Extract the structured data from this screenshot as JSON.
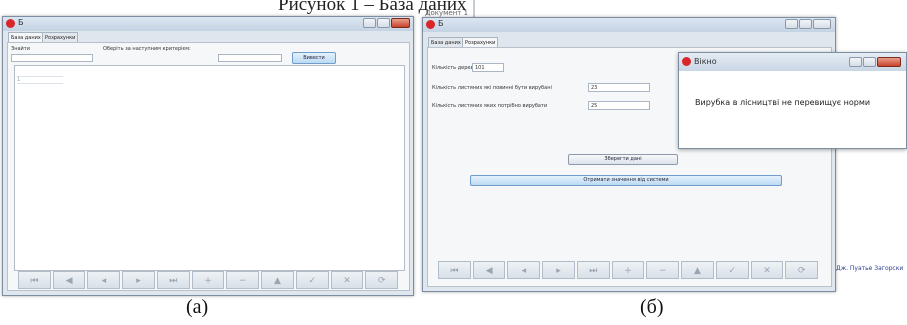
{
  "caption_top": "Рисунок 1 – База даних",
  "left": {
    "title": "Б",
    "tabs": [
      "База даних",
      "Розрахунки"
    ],
    "search_label": "Знайти",
    "hint": "Оберіть за наступним критерієм:",
    "button": "Вивести",
    "grid_rows": [
      "",
      "1"
    ],
    "caption": "(а)"
  },
  "right": {
    "header_text": "Документ 1",
    "title": "Б",
    "tabs": [
      "База даних",
      "Розрахунки"
    ],
    "rows": [
      {
        "label": "Кількість дерев",
        "value": "101"
      },
      {
        "label": "Кількість листяних які повинні бути вирубані",
        "value": "23"
      },
      {
        "label": "Кількість листяних яких потрібно вирубати",
        "value": "25"
      }
    ],
    "button_center": "Зберегти дані",
    "button_wide": "Отримати значення від системи",
    "side_note": "Дж. Пуатье Загорски",
    "caption": "(б)"
  },
  "dialog": {
    "title": "Вікно",
    "message": "Вирубка в лісництві не перевищує норми"
  },
  "tool_icons": [
    "prev-icon",
    "rewind-icon",
    "back-icon",
    "forward-icon",
    "next-icon",
    "plus-icon",
    "minus-icon",
    "up-icon",
    "check-icon",
    "cancel-icon",
    "refresh-icon"
  ],
  "tool_glyphs": [
    "⏮",
    "◀",
    "◂",
    "▸",
    "⏭",
    "+",
    "−",
    "▲",
    "✓",
    "✕",
    "⟳"
  ]
}
